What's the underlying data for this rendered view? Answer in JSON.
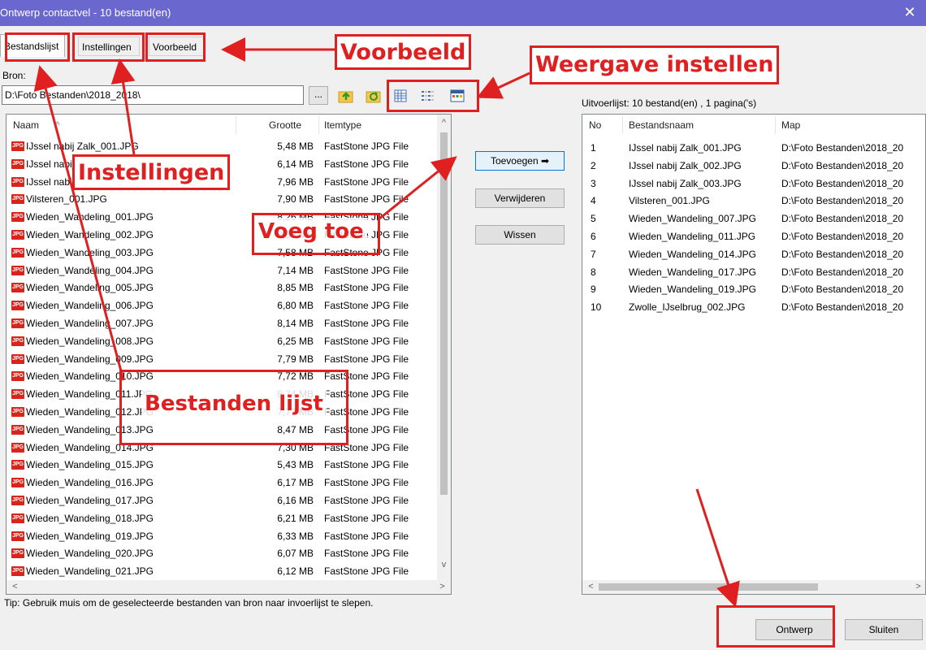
{
  "window": {
    "title": "Ontwerp contactvel - 10 bestand(en)",
    "close_glyph": "✕"
  },
  "tabs": [
    {
      "label": "Bestandslijst"
    },
    {
      "label": "Instellingen"
    },
    {
      "label": "Voorbeeld"
    }
  ],
  "source": {
    "label": "Bron:",
    "path": "D:\\Foto Bestanden\\2018_2018\\",
    "browse_label": "...",
    "columns": [
      "Naam",
      "Grootte",
      "Itemtype"
    ],
    "files": [
      {
        "name": "IJssel nabij Zalk_001.JPG",
        "size": "5,48 MB",
        "type": "FastStone JPG File"
      },
      {
        "name": "IJssel nabij Zalk_002.JPG",
        "size": "6,14 MB",
        "type": "FastStone JPG File"
      },
      {
        "name": "IJssel nabij Zalk_003.JPG",
        "size": "7,96 MB",
        "type": "FastStone JPG File"
      },
      {
        "name": "Vilsteren_001.JPG",
        "size": "7,90 MB",
        "type": "FastStone JPG File"
      },
      {
        "name": "Wieden_Wandeling_001.JPG",
        "size": "8,26 MB",
        "type": "FastStone JPG File"
      },
      {
        "name": "Wieden_Wandeling_002.JPG",
        "size": "8,53 MB",
        "type": "FastStone JPG File"
      },
      {
        "name": "Wieden_Wandeling_003.JPG",
        "size": "7,58 MB",
        "type": "FastStone JPG File"
      },
      {
        "name": "Wieden_Wandeling_004.JPG",
        "size": "7,14 MB",
        "type": "FastStone JPG File"
      },
      {
        "name": "Wieden_Wandeling_005.JPG",
        "size": "8,85 MB",
        "type": "FastStone JPG File"
      },
      {
        "name": "Wieden_Wandeling_006.JPG",
        "size": "6,80 MB",
        "type": "FastStone JPG File"
      },
      {
        "name": "Wieden_Wandeling_007.JPG",
        "size": "8,14 MB",
        "type": "FastStone JPG File"
      },
      {
        "name": "Wieden_Wandeling_008.JPG",
        "size": "6,25 MB",
        "type": "FastStone JPG File"
      },
      {
        "name": "Wieden_Wandeling_009.JPG",
        "size": "7,79 MB",
        "type": "FastStone JPG File"
      },
      {
        "name": "Wieden_Wandeling_010.JPG",
        "size": "7,72 MB",
        "type": "FastStone JPG File"
      },
      {
        "name": "Wieden_Wandeling_011.JPG",
        "size": "8,74 MB",
        "type": "FastStone JPG File"
      },
      {
        "name": "Wieden_Wandeling_012.JPG",
        "size": "7,77 MB",
        "type": "FastStone JPG File"
      },
      {
        "name": "Wieden_Wandeling_013.JPG",
        "size": "8,47 MB",
        "type": "FastStone JPG File"
      },
      {
        "name": "Wieden_Wandeling_014.JPG",
        "size": "7,30 MB",
        "type": "FastStone JPG File"
      },
      {
        "name": "Wieden_Wandeling_015.JPG",
        "size": "5,43 MB",
        "type": "FastStone JPG File"
      },
      {
        "name": "Wieden_Wandeling_016.JPG",
        "size": "6,17 MB",
        "type": "FastStone JPG File"
      },
      {
        "name": "Wieden_Wandeling_017.JPG",
        "size": "6,16 MB",
        "type": "FastStone JPG File"
      },
      {
        "name": "Wieden_Wandeling_018.JPG",
        "size": "6,21 MB",
        "type": "FastStone JPG File"
      },
      {
        "name": "Wieden_Wandeling_019.JPG",
        "size": "6,33 MB",
        "type": "FastStone JPG File"
      },
      {
        "name": "Wieden_Wandeling_020.JPG",
        "size": "6,07 MB",
        "type": "FastStone JPG File"
      },
      {
        "name": "Wieden_Wandeling_021.JPG",
        "size": "6,12 MB",
        "type": "FastStone JPG File"
      }
    ],
    "file_icon_text": "JPG"
  },
  "actions": {
    "add": "Toevoegen ➡",
    "remove": "Verwijderen",
    "clear": "Wissen"
  },
  "output": {
    "summary": "Uitvoerlijst: 10 bestand(en) , 1 pagina('s)",
    "columns": [
      "No",
      "Bestandsnaam",
      "Map"
    ],
    "rows": [
      {
        "no": "1",
        "name": "IJssel nabij Zalk_001.JPG",
        "folder": "D:\\Foto Bestanden\\2018_20"
      },
      {
        "no": "2",
        "name": "IJssel nabij Zalk_002.JPG",
        "folder": "D:\\Foto Bestanden\\2018_20"
      },
      {
        "no": "3",
        "name": "IJssel nabij Zalk_003.JPG",
        "folder": "D:\\Foto Bestanden\\2018_20"
      },
      {
        "no": "4",
        "name": "Vilsteren_001.JPG",
        "folder": "D:\\Foto Bestanden\\2018_20"
      },
      {
        "no": "5",
        "name": "Wieden_Wandeling_007.JPG",
        "folder": "D:\\Foto Bestanden\\2018_20"
      },
      {
        "no": "6",
        "name": "Wieden_Wandeling_011.JPG",
        "folder": "D:\\Foto Bestanden\\2018_20"
      },
      {
        "no": "7",
        "name": "Wieden_Wandeling_014.JPG",
        "folder": "D:\\Foto Bestanden\\2018_20"
      },
      {
        "no": "8",
        "name": "Wieden_Wandeling_017.JPG",
        "folder": "D:\\Foto Bestanden\\2018_20"
      },
      {
        "no": "9",
        "name": "Wieden_Wandeling_019.JPG",
        "folder": "D:\\Foto Bestanden\\2018_20"
      },
      {
        "no": "10",
        "name": "Zwolle_IJselbrug_002.JPG",
        "folder": "D:\\Foto Bestanden\\2018_20"
      }
    ]
  },
  "tip": "Tip: Gebruik muis om de geselecteerde bestanden van bron naar invoerlijst te slepen.",
  "footer": {
    "design": "Ontwerp",
    "close": "Sluiten"
  },
  "annotations": {
    "voorbeeld": "Voorbeeld",
    "weergave": "Weergave instellen",
    "instellingen": "Instellingen",
    "voeg_toe": "Voeg toe",
    "bestanden_lijst": "Bestanden lijst"
  },
  "colors": {
    "titlebar": "#6a67cf",
    "annotation": "#e02020",
    "jpg_badge": "#d8241c"
  }
}
